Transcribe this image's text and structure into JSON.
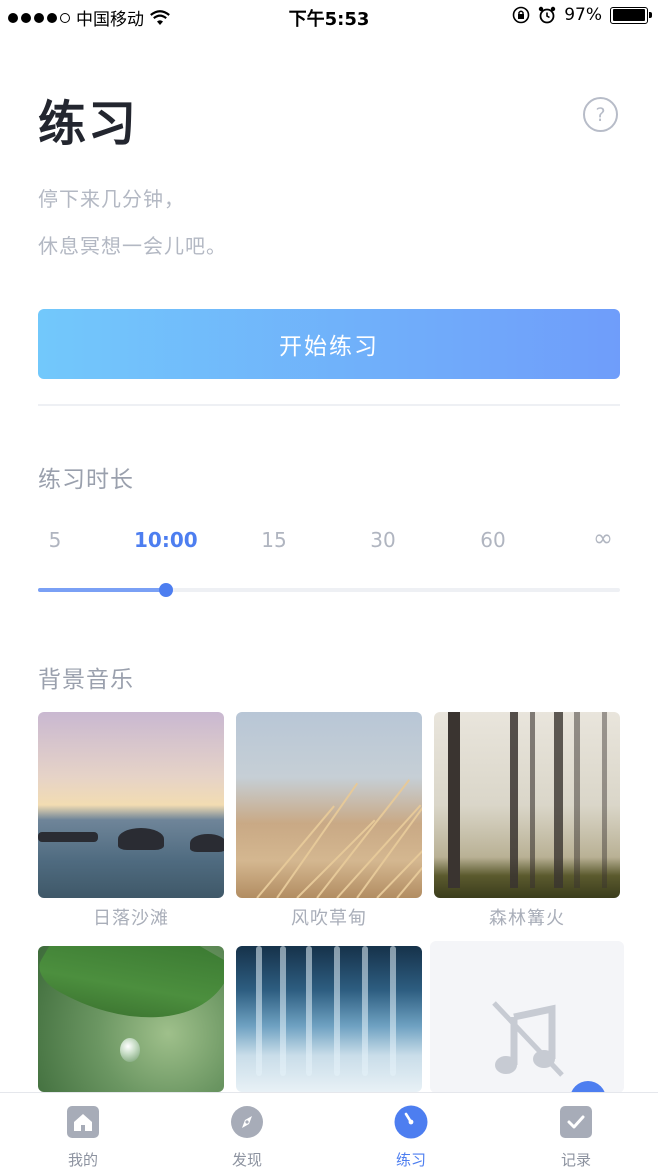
{
  "status_bar": {
    "carrier": "中国移动",
    "time": "下午5:53",
    "battery": "97%",
    "battery_level": 0.97,
    "icons": [
      "signal-icon",
      "wifi-icon",
      "rotation-lock-icon",
      "alarm-icon",
      "battery-icon"
    ]
  },
  "header": {
    "title": "练习",
    "help_label": "?"
  },
  "subtitle": {
    "line1": "停下来几分钟，",
    "line2": "休息冥想一会儿吧。"
  },
  "start_button": "开始练习",
  "duration": {
    "title": "练习时长",
    "options": [
      "5",
      "10:00",
      "15",
      "30",
      "60",
      "∞"
    ],
    "selected": "10:00",
    "selected_index": 1,
    "slider_fraction": 0.22
  },
  "music": {
    "title": "背景音乐",
    "items": [
      {
        "label": "日落沙滩"
      },
      {
        "label": "风吹草甸"
      },
      {
        "label": "森林篝火"
      },
      {
        "label": ""
      },
      {
        "label": ""
      },
      {
        "label": ""
      }
    ]
  },
  "tabs": [
    {
      "label": "我的",
      "icon": "home-icon"
    },
    {
      "label": "发现",
      "icon": "compass-icon"
    },
    {
      "label": "练习",
      "icon": "timer-icon",
      "active": true
    },
    {
      "label": "记录",
      "icon": "check-icon"
    }
  ],
  "colors": {
    "accent": "#4d7ef0",
    "button_gradient_start": "#72c8fb",
    "button_gradient_end": "#6f9dfa",
    "muted_text": "#b3b8c3"
  }
}
